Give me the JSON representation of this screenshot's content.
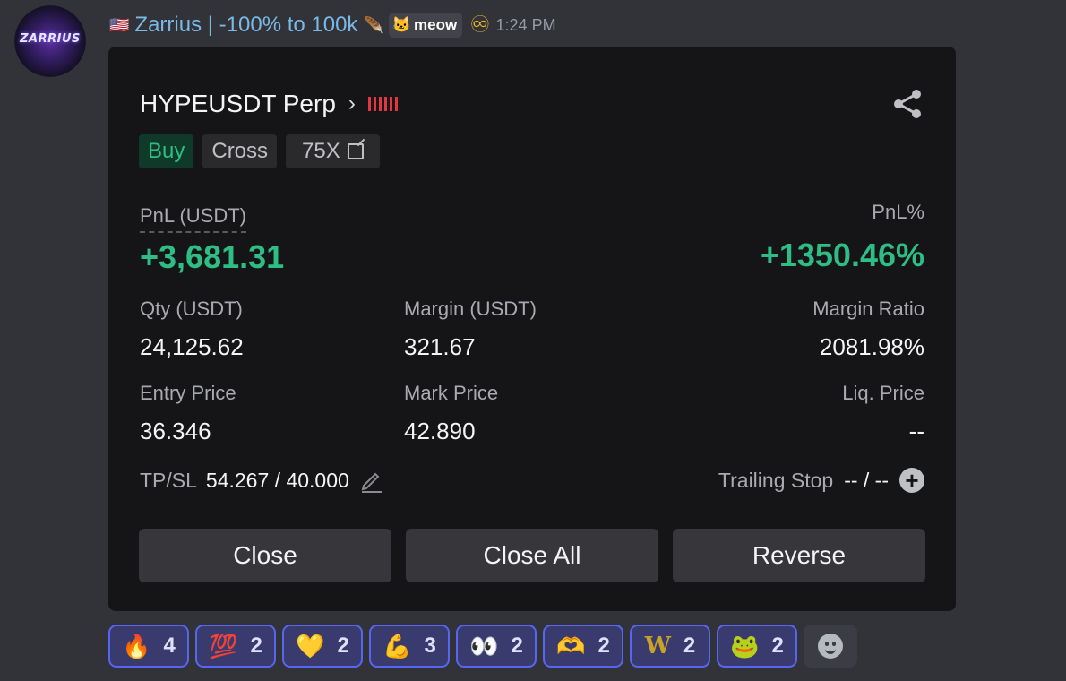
{
  "message": {
    "avatar_text": "ZARRIUS",
    "flag": "🇺🇸",
    "username": "Zarrius | -100% to 100k",
    "feather": "🪶",
    "tag_emoji": "🐱",
    "tag": "meow",
    "badge": "♾",
    "time": "1:24 PM"
  },
  "card": {
    "pair": "HYPEUSDT Perp",
    "chevron": "›",
    "side": "Buy",
    "margin_mode": "Cross",
    "leverage": "75X",
    "pnl_label": "PnL (USDT)",
    "pnl_value": "+3,681.31",
    "pnl_pct_label": "PnL%",
    "pnl_pct_value": "+1350.46%",
    "qty_label": "Qty (USDT)",
    "qty_value": "24,125.62",
    "margin_label": "Margin (USDT)",
    "margin_value": "321.67",
    "margin_ratio_label": "Margin Ratio",
    "margin_ratio_value": "2081.98%",
    "entry_label": "Entry Price",
    "entry_value": "36.346",
    "mark_label": "Mark Price",
    "mark_value": "42.890",
    "liq_label": "Liq. Price",
    "liq_value": "--",
    "tpsl_label": "TP/SL",
    "tpsl_value": "54.267 / 40.000",
    "trailing_label": "Trailing Stop",
    "trailing_value": "-- / --",
    "buttons": {
      "close": "Close",
      "close_all": "Close All",
      "reverse": "Reverse"
    }
  },
  "reactions": [
    {
      "emoji": "🔥",
      "count": "4"
    },
    {
      "emoji": "💯",
      "count": "2"
    },
    {
      "emoji": "💛",
      "count": "2"
    },
    {
      "emoji": "💪",
      "count": "3"
    },
    {
      "emoji": "👀",
      "count": "2"
    },
    {
      "emoji": "🫶",
      "count": "2"
    },
    {
      "emoji": "W",
      "count": "2"
    },
    {
      "emoji": "🐸",
      "count": "2"
    }
  ],
  "colors": {
    "profit": "#2ebd85",
    "accent": "#5865f2",
    "username": "#7ab8e6",
    "bars": "#e0383e"
  }
}
